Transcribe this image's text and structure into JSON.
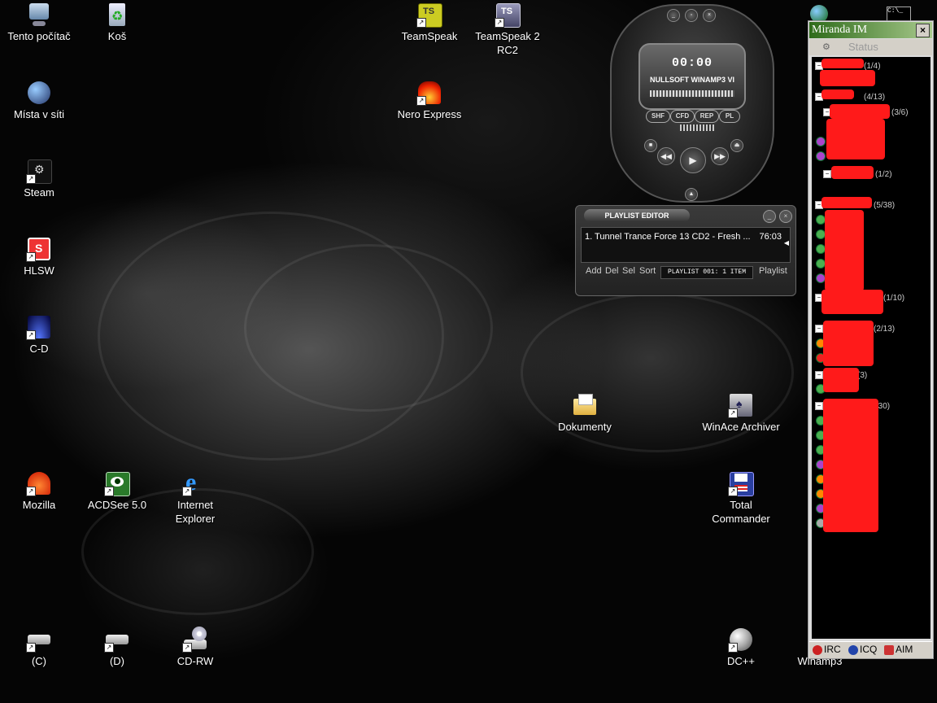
{
  "desktop": {
    "icons": {
      "my_computer": "Tento počítač",
      "recycle_bin": "Koš",
      "network_places": "Místa v síti",
      "steam": "Steam",
      "hlsw": "HLSW",
      "cd": "C-D",
      "mozilla": "Mozilla",
      "acdsee": "ACDSee 5.0",
      "ie": "Internet Explorer",
      "drive_c": "(C)",
      "drive_d": "(D)",
      "cdrw": "CD-RW",
      "teamspeak": "TeamSpeak",
      "teamspeak2": "TeamSpeak 2 RC2",
      "nero": "Nero Express",
      "documents": "Dokumenty",
      "winace": "WinAce Archiver",
      "total_commander": "Total Commander",
      "dcpp": "DC++",
      "winamp3": "Winamp3"
    }
  },
  "winamp": {
    "time": "00:00",
    "title": "NULLSOFT WINAMP3 VI",
    "buttons": {
      "shf": "SHF",
      "cfd": "CFD",
      "rep": "REP",
      "pl": "PL"
    }
  },
  "playlist": {
    "title": "PLAYLIST EDITOR",
    "item": "1.  Tunnel Trance Force 13 CD2 - Fresh ...",
    "duration": "76:03",
    "buttons": {
      "add": "Add",
      "del": "Del",
      "sel": "Sel",
      "sort": "Sort",
      "playlist": "Playlist"
    },
    "info": "PLAYLIST 001: 1 ITEM"
  },
  "miranda": {
    "title": "Miranda IM",
    "status": "Status",
    "groups": [
      {
        "count": "(1/4)"
      },
      {
        "count": "(4/13)"
      },
      {
        "count": "(3/6)"
      },
      {
        "count": "(1/2)"
      },
      {
        "count": "(5/38)"
      },
      {
        "count": "(1/10)"
      },
      {
        "count": "(2/13)"
      },
      {
        "count": "(3)"
      },
      {
        "count": "(8/30)"
      }
    ],
    "tabs": {
      "irc": "IRC",
      "icq": "ICQ",
      "aim": "AIM"
    }
  }
}
